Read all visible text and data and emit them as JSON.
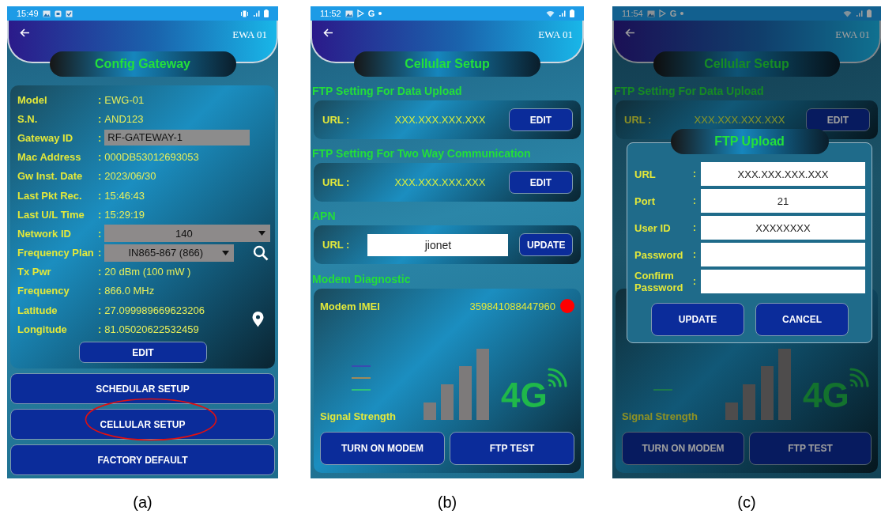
{
  "panels": [
    {
      "kind": "config",
      "dimmed": false,
      "caption": "(a)",
      "status_bar": {
        "time": "15:49"
      },
      "header": {
        "device": "EWA 01"
      },
      "title": "Config Gateway",
      "info_rows": [
        {
          "label": "Model",
          "sep": ":",
          "value": "EWG-01",
          "kind": "text"
        },
        {
          "label": "S.N.",
          "sep": ":",
          "value": "AND123",
          "kind": "text"
        },
        {
          "label": "Gateway ID",
          "sep": ":",
          "value": "RF-GATEWAY-1",
          "kind": "field"
        },
        {
          "label": "Mac Address",
          "sep": ":",
          "value": "000DB53012693053",
          "kind": "text"
        },
        {
          "label": "Gw Inst. Date",
          "sep": ":",
          "value": "2023/06/30",
          "kind": "text"
        },
        {
          "label": "Last Pkt Rec.",
          "sep": ":",
          "value": "15:46:43",
          "kind": "text"
        },
        {
          "label": "Last U/L Time",
          "sep": ":",
          "value": "15:29:19",
          "kind": "text"
        },
        {
          "label": "Network ID",
          "sep": ":",
          "value": "140",
          "kind": "dropdown"
        },
        {
          "label": "Frequency Plan",
          "sep": ":",
          "value": "IN865-867 (866)",
          "kind": "dropdown",
          "search_button": true
        },
        {
          "label": "Tx Pwr",
          "sep": ":",
          "value": "20 dBm (100 mW )",
          "kind": "text"
        },
        {
          "label": "Frequency",
          "sep": ":",
          "value": "866.0 MHz",
          "kind": "text"
        },
        {
          "label": "Latitude",
          "sep": ":",
          "value": "27.099989669623206",
          "kind": "text",
          "locate_button": true
        },
        {
          "label": "Longitude",
          "sep": ":",
          "value": "81.05020622532459",
          "kind": "text"
        }
      ],
      "edit_button": "EDIT",
      "menu_buttons": [
        {
          "label": "SCHEDULAR SETUP",
          "circled": false
        },
        {
          "label": "CELLULAR SETUP",
          "circled": true
        },
        {
          "label": "FACTORY DEFAULT",
          "circled": false
        }
      ]
    },
    {
      "kind": "cellular",
      "dimmed": false,
      "caption": "(b)",
      "status_bar": {
        "time": "11:52",
        "app_letter": "G"
      },
      "header": {
        "device": "EWA 01"
      },
      "title": "Cellular Setup",
      "sections": [
        {
          "heading": "FTP Setting For Data Upload",
          "kind": "value",
          "label": "URL :",
          "value": "XXX.XXX.XXX.XXX",
          "button": "EDIT"
        },
        {
          "heading": "FTP Setting For Two Way Communication",
          "kind": "value",
          "label": "URL :",
          "value": "XXX.XXX.XXX.XXX",
          "button": "EDIT"
        },
        {
          "heading": "APN",
          "kind": "input",
          "label": "URL :",
          "value": "jionet",
          "button": "UPDATE"
        }
      ],
      "diagnostic": {
        "heading": "Modem Diagnostic",
        "imei": {
          "label": "Modem IMEI",
          "value": "359841088447960",
          "color": "#ff0000"
        },
        "readings": [
          {
            "color": "#3a4cb0"
          },
          {
            "color": "#a08a5a"
          },
          {
            "color": "#2ec27a"
          }
        ],
        "signal_label": "Signal Strength",
        "network": "4G",
        "buttons": [
          "TURN ON MODEM",
          "FTP TEST"
        ]
      }
    },
    {
      "kind": "cellular",
      "dimmed": true,
      "caption": "(c)",
      "status_bar": {
        "time": "11:54",
        "app_letter": "G"
      },
      "header": {
        "device": "EWA 01"
      },
      "title": "Cellular Setup",
      "sections": [
        {
          "heading": "FTP Setting For Data Upload",
          "kind": "value",
          "label": "URL :",
          "value": "XXX.XXX.XXX.XXX",
          "button": "EDIT"
        }
      ],
      "diagnostic": {
        "readings": [
          {
            "color": "#1d784c"
          }
        ],
        "signal_label": "Signal Strength",
        "network": "4G",
        "buttons": [
          "TURN ON MODEM",
          "FTP TEST"
        ]
      },
      "dialog": {
        "title": "FTP Upload",
        "fields": [
          {
            "label": "URL",
            "sep": ":",
            "value": "XXX.XXX.XXX.XXX"
          },
          {
            "label": "Port",
            "sep": ":",
            "value": "21"
          },
          {
            "label": "User ID",
            "sep": ":",
            "value": "XXXXXXXX"
          },
          {
            "label": "Password",
            "sep": ":"
          },
          {
            "label": "Confirm Password",
            "sep": ":"
          }
        ],
        "buttons": [
          "UPDATE",
          "CANCEL"
        ]
      }
    }
  ]
}
